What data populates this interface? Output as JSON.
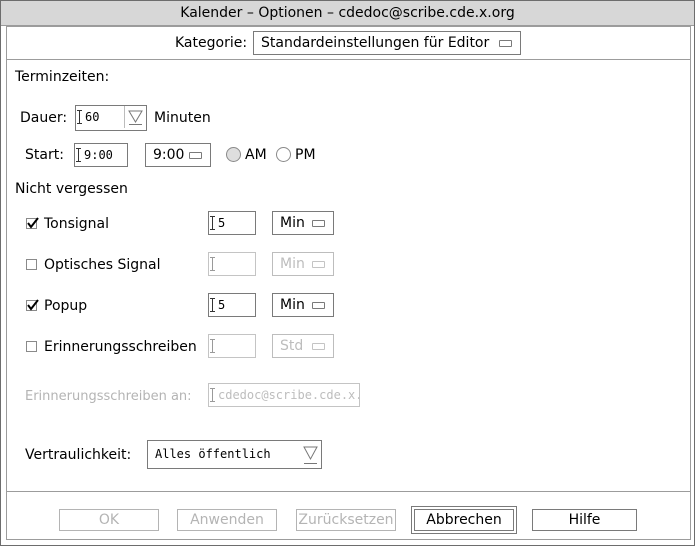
{
  "window": {
    "title": "Kalender –  Optionen – cdedoc@scribe.cde.x.org"
  },
  "category": {
    "label": "Kategorie:",
    "value": "Standardeinstellungen für Editor"
  },
  "appointment_times": {
    "heading": "Terminzeiten:",
    "duration": {
      "label": "Dauer:",
      "value": "60",
      "unit": "Minuten"
    },
    "start": {
      "label": "Start:",
      "value": "9:00",
      "select_value": "9:00",
      "am_label": "AM",
      "pm_label": "PM",
      "selected": "AM"
    }
  },
  "reminders": {
    "heading": "Nicht vergessen",
    "items": [
      {
        "label": "Tonsignal",
        "checked": true,
        "value": "5",
        "unit": "Min",
        "enabled": true
      },
      {
        "label": "Optisches Signal",
        "checked": false,
        "value": "",
        "unit": "Min",
        "enabled": false
      },
      {
        "label": "Popup",
        "checked": true,
        "value": "5",
        "unit": "Min",
        "enabled": true
      },
      {
        "label": "Erinnerungsschreiben",
        "checked": false,
        "value": "",
        "unit": "Std",
        "enabled": false
      }
    ],
    "mail_to": {
      "label": "Erinnerungsschreiben an:",
      "value": "cdedoc@scribe.cde.x."
    }
  },
  "privacy": {
    "label": "Vertraulichkeit:",
    "value": "Alles öffentlich"
  },
  "buttons": {
    "ok": "OK",
    "apply": "Anwenden",
    "reset": "Zurücksetzen",
    "cancel": "Abbrechen",
    "help": "Hilfe"
  }
}
